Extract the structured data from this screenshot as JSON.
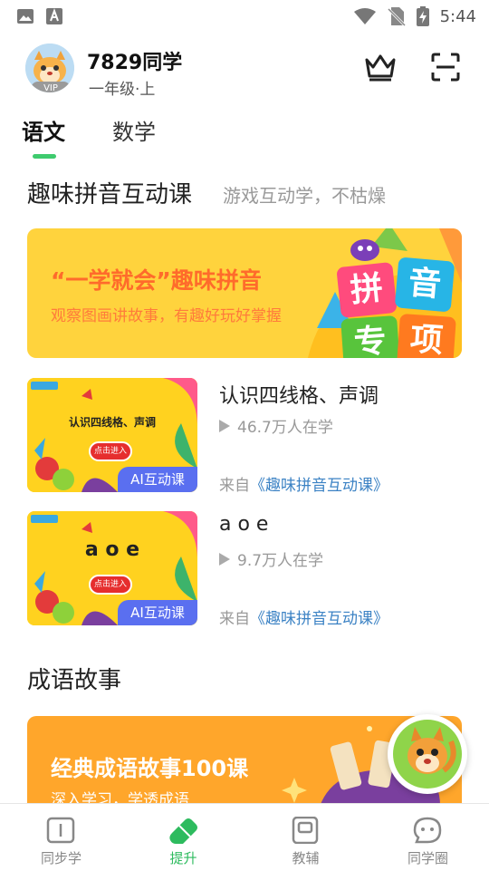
{
  "status_bar": {
    "time": "5:44"
  },
  "user": {
    "name": "7829同学",
    "grade": "一年级·上",
    "vip_label": "VIP"
  },
  "tabs": [
    {
      "label": "语文",
      "active": true
    },
    {
      "label": "数学",
      "active": false
    }
  ],
  "pinyin_section": {
    "title": "趣味拼音互动课",
    "subtitle": "游戏互动学，不枯燥",
    "banner": {
      "title": "“一学就会”趣味拼音",
      "subtitle": "观察图画讲故事，有趣好玩好掌握",
      "badge_chars": [
        "拼",
        "音",
        "专",
        "项"
      ]
    }
  },
  "lessons": [
    {
      "thumb_title": "认识四线格、声调",
      "thumb_button": "点击进入",
      "badge": "AI互动课",
      "title": "认识四线格、声调",
      "stats": "46.7万人在学",
      "source_prefix": "来自",
      "source_link": "《趣味拼音互动课》"
    },
    {
      "thumb_title": "a o e",
      "thumb_button": "点击进入",
      "badge": "AI互动课",
      "title": "a o e",
      "stats": "9.7万人在学",
      "source_prefix": "来自",
      "source_link": "《趣味拼音互动课》"
    }
  ],
  "idiom_section": {
    "title": "成语故事",
    "banner": {
      "title": "经典成语故事100课",
      "subtitle": "深入学习，学透成语"
    }
  },
  "bottom_nav": [
    {
      "label": "同步学",
      "icon": "book-icon",
      "active": false
    },
    {
      "label": "提升",
      "icon": "eraser-icon",
      "active": true
    },
    {
      "label": "教辅",
      "icon": "workbook-icon",
      "active": false
    },
    {
      "label": "同学圈",
      "icon": "chat-bubble-icon",
      "active": false
    }
  ],
  "colors": {
    "accent_green": "#3ecb6e",
    "banner_yellow": "#ffd33d",
    "link_blue": "#3b82c4",
    "ai_badge": "#5a6ff0"
  }
}
